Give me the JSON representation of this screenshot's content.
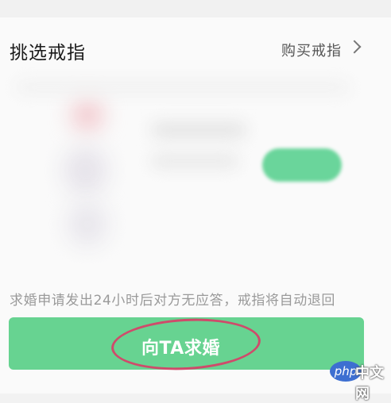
{
  "section": {
    "title": "挑选戒指",
    "buy_link": "购买戒指"
  },
  "notice": "求婚申请发出24小时后对方无应答，戒指将自动退回",
  "propose_button": {
    "label": "向TA求婚"
  },
  "watermark": {
    "badge": "php",
    "text": "中文网"
  },
  "colors": {
    "accent": "#67d391",
    "highlight": "#cf4b6b",
    "text": "#1a1a1a",
    "muted": "#9a9a9a"
  },
  "icons": [
    "chevron-right-icon"
  ]
}
